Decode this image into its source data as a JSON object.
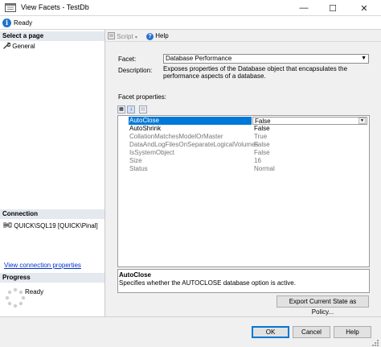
{
  "window": {
    "title": "View Facets - TestDb",
    "minimize": "—",
    "maximize": "☐",
    "close": "✕"
  },
  "status": {
    "text": "Ready",
    "icon": "info-icon"
  },
  "left_pane": {
    "select_page_header": "Select a page",
    "pages": [
      {
        "label": "General",
        "icon": "wrench-icon"
      }
    ],
    "connection_header": "Connection",
    "connection_server": "QUICK\\SQL19 [QUICK\\Pinal]",
    "connection_link": "View connection properties",
    "progress_header": "Progress",
    "progress_status": "Ready"
  },
  "toolbar": {
    "script_label": "Script",
    "help_label": "Help"
  },
  "facet": {
    "facet_label": "Facet:",
    "facet_value": "Database Performance",
    "description_label": "Description:",
    "description_text": "Exposes properties of the Database object that encapsulates the performance aspects of a database.",
    "properties_label": "Facet properties:"
  },
  "properties": [
    {
      "name": "AutoClose",
      "value": "False",
      "readonly": false,
      "selected": true
    },
    {
      "name": "AutoShrink",
      "value": "False",
      "readonly": false,
      "selected": false
    },
    {
      "name": "CollationMatchesModelOrMaster",
      "value": "True",
      "readonly": true,
      "selected": false
    },
    {
      "name": "DataAndLogFilesOnSeparateLogicalVolumes",
      "value": "False",
      "readonly": true,
      "selected": false
    },
    {
      "name": "IsSystemObject",
      "value": "False",
      "readonly": true,
      "selected": false
    },
    {
      "name": "Size",
      "value": "16",
      "readonly": true,
      "selected": false
    },
    {
      "name": "Status",
      "value": "Normal",
      "readonly": true,
      "selected": false
    }
  ],
  "help_panel": {
    "title": "AutoClose",
    "text": "Specifies whether the AUTOCLOSE database option is active."
  },
  "buttons": {
    "export": "Export Current State as Policy...",
    "ok": "OK",
    "cancel": "Cancel",
    "help": "Help"
  },
  "colors": {
    "selection": "#0078d7",
    "section_header": "#e4e8ef",
    "link": "#0033cc"
  }
}
